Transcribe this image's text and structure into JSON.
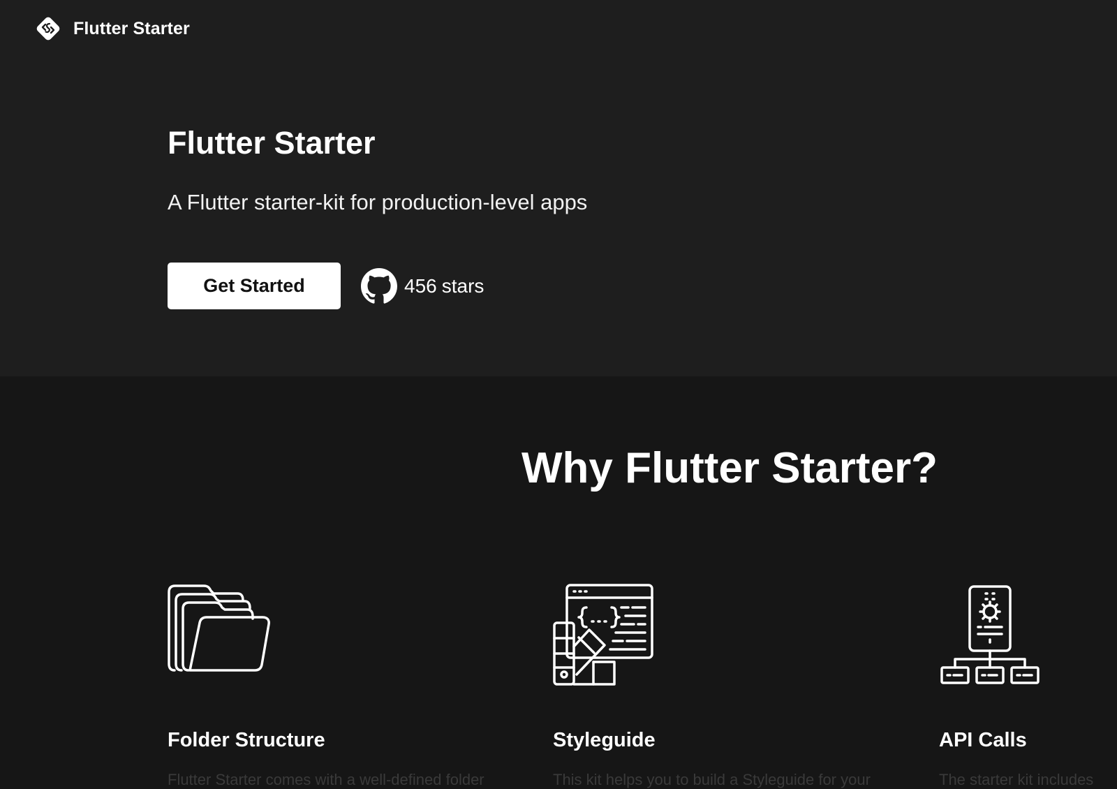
{
  "nav": {
    "brand_name": "Flutter Starter",
    "logo_icon": "flutter-starter-logo-icon"
  },
  "hero": {
    "title": "Flutter Starter",
    "subtitle": "A Flutter starter-kit for production-level apps",
    "cta_label": "Get Started",
    "github": {
      "icon": "github-icon",
      "star_count": "456",
      "star_label": "stars"
    }
  },
  "why": {
    "title": "Why Flutter Starter?"
  },
  "features": [
    {
      "icon": "folder-stack-icon",
      "title": "Folder Structure",
      "description": "Flutter Starter comes with a well-defined folder"
    },
    {
      "icon": "styleguide-palette-icon",
      "title": "Styleguide",
      "description": "This kit helps you to build a Styleguide for your"
    },
    {
      "icon": "api-network-icon",
      "title": "API Calls",
      "description": "The starter kit includes"
    }
  ],
  "colors": {
    "hero_bg": "#1e1e1e",
    "page_bg": "#161616",
    "text": "#ffffff",
    "button_bg": "#ffffff",
    "button_text": "#111111",
    "faded_text": "#3a3a3a"
  }
}
